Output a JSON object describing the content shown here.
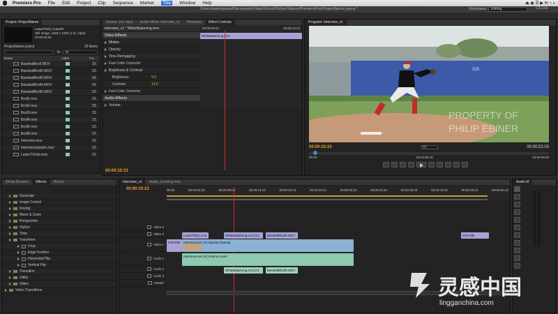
{
  "menubar": {
    "app": "Premiere Pro",
    "items": [
      "File",
      "Edit",
      "Project",
      "Clip",
      "Sequence",
      "Marker",
      "Title",
      "Window",
      "Help"
    ],
    "highlight": "Title",
    "right": "CS Live"
  },
  "window_title": "/Users/samrsjones/Documents/VideoSchoolOnline/Videos/PremierePro/ProjectName.prproj *",
  "workspace": {
    "label": "Workspace:",
    "value": "Editing"
  },
  "project": {
    "tab": "Project: ProjectName",
    "thumb_name": "LowerThird_CoachG",
    "thumb_info1": "Still Image, 1920 x 1080 (1.0), Alpha",
    "thumb_info2": "00:00:05:04",
    "proj_file": "ProjectName.prproj",
    "items_count": "29 Items",
    "in_label": "In:",
    "in_value": "All",
    "col_name": "Name",
    "col_label": "Label",
    "col_rate": "Fra",
    "items": [
      {
        "name": "BaseballBroll.MOV",
        "rate": "23.",
        "color": "#8fc9b0"
      },
      {
        "name": "BaseballBroll2.MOV",
        "rate": "23.",
        "color": "#8fc9b0"
      },
      {
        "name": "BaseballBroll3.MOV",
        "rate": "59.",
        "color": "#8fc9b0"
      },
      {
        "name": "BaseballBroll4.MOV",
        "rate": "59.",
        "color": "#8fc9b0"
      },
      {
        "name": "BaseballBroll5.MOV",
        "rate": "23.",
        "color": "#8fc9b0"
      },
      {
        "name": "Broll1.mov",
        "rate": "23.",
        "color": "#8fc9b0"
      },
      {
        "name": "Broll2.mov",
        "rate": "23.",
        "color": "#8fc9b0"
      },
      {
        "name": "Broll3.mov",
        "rate": "23.",
        "color": "#8fc9b0"
      },
      {
        "name": "Broll4.mov",
        "rate": "23.",
        "color": "#8fc9b0"
      },
      {
        "name": "Broll5.mov",
        "rate": "23.",
        "color": "#8fc9b0"
      },
      {
        "name": "Broll6.mov",
        "rate": "23.",
        "color": "#8fc9b0"
      },
      {
        "name": "Interview.mov",
        "rate": "23.",
        "color": "#8fc9b0"
      },
      {
        "name": "InterviewSample.mov",
        "rate": "23.",
        "color": "#8fc9b0"
      },
      {
        "name": "LowerThirds.mov",
        "rate": "23.",
        "color": "#8fc9b0"
      }
    ]
  },
  "source_tabs": [
    "Source: (no clips)",
    "Audio Mixer: Interview_v1",
    "Metadata",
    "Effect Controls"
  ],
  "effects_ctrl": {
    "seq": "Interview_v1 * WhiteBalancing.mov",
    "tc_start": "00:00:09:23",
    "tc_end": "00:00:14:23",
    "clip_label": "WhiteBalancing.mov",
    "video_effects": "Video Effects",
    "rows": [
      "Motion",
      "Opacity",
      "Time Remapping",
      "Fast Color Corrector",
      "Brightness & Contrast"
    ],
    "brightness_label": "Brightness",
    "brightness_value": "5.0",
    "contrast_label": "Contrast",
    "contrast_value": "14.0",
    "fcc2": "Fast Color Corrector",
    "audio_effects": "Audio Effects",
    "volume": "Volume",
    "bottom_tc": "00:00:10:23"
  },
  "program": {
    "tab": "Program: Interview_v1",
    "watermark1": "PROPERTY OF",
    "watermark2": "PHILIP EBINER",
    "score": "325",
    "tc_current": "00:00:10:23",
    "fit": "Fit",
    "tc_total": "00:00:52:03",
    "ruler": [
      "00:00",
      "00:04:59:16",
      "00:09:59:09"
    ]
  },
  "effects_panel": {
    "tabs": [
      "Media Browser",
      "Effects",
      "History"
    ],
    "items": [
      "Generate",
      "Image Control",
      "Keying",
      "Noise & Grain",
      "Perspective",
      "Stylize",
      "Time",
      "Transform"
    ],
    "transform_children": [
      "Crop",
      "Edge Feather",
      "Horizontal Flip",
      "Vertical Flip"
    ],
    "after": [
      "Transition",
      "Utility",
      "Video"
    ],
    "video_transitions": "Video Transitions"
  },
  "timeline": {
    "tabs": [
      "Interview_v1",
      "Audio_Leveling.mov"
    ],
    "tc": "00:00:10:23",
    "ruler": [
      "00:00",
      "00:00:04:23",
      "00:00:09:23",
      "00:00:14:23",
      "00:00:19:23",
      "00:00:24:23",
      "00:00:29:23",
      "00:00:34:23",
      "00:00:39:23",
      "00:00:44:22",
      "00:00:49:22",
      "00:00:54:22"
    ],
    "tracks": [
      "Video 3",
      "Video 2",
      "Video 1",
      "Audio 1",
      "Audio 2",
      "Audio 3",
      "Master"
    ],
    "clips": {
      "lt": "LowerThird_Coa",
      "wb": "WhiteBalancing.mov [V]",
      "bb": "BaseballBroll5.MOV",
      "intro": "IntroTitle",
      "intro_v1": "IntroTitle",
      "interview_v": "Interview.mov [V] Opacity:Opacity",
      "interview_a": "Interview.mov [A] Volume:Level",
      "wb_a": "WhiteBalancing.mov [A]",
      "bb_a": "BaseballBroll5.MOV"
    }
  },
  "audio_master": {
    "tab": "Audio M"
  },
  "brand": {
    "logo_text": "灵感中国",
    "url": "lingganchina.com"
  }
}
